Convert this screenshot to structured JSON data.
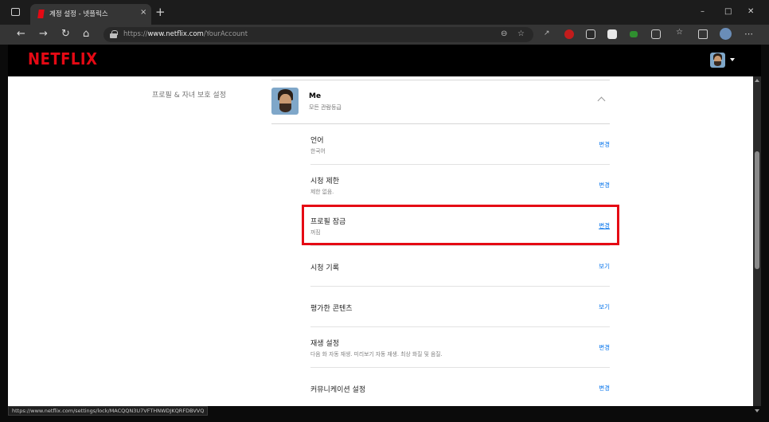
{
  "browser": {
    "tab_title": "계정 설정 - 넷플릭스",
    "tab_close": "×",
    "new_tab": "+",
    "url_scheme": "https://",
    "url_host": "www.netflix.com",
    "url_path": "/YourAccount",
    "window_controls": {
      "minimize": "–",
      "maximize": "□",
      "close": "✕"
    },
    "nav": {
      "back": "←",
      "forward": "→",
      "reload": "↻",
      "home": "⌂"
    },
    "toolbar_more": "⋯",
    "status_url": "https://www.netflix.com/settings/lock/MACQQN3U7VFTHNWDJKQRFDBVVQ"
  },
  "netflix": {
    "logo": "NETFLIX",
    "section_label": "프로필 & 자녀 보호 설정",
    "profile": {
      "name": "Me",
      "maturity": "모든 관람등급"
    },
    "settings": [
      {
        "title": "언어",
        "subtitle": "한국어",
        "action": "변경"
      },
      {
        "title": "시청 제한",
        "subtitle": "제한 없음.",
        "action": "변경"
      },
      {
        "title": "프로필 잠금",
        "subtitle": "꺼짐",
        "action": "변경",
        "highlighted": true
      },
      {
        "title": "시청 기록",
        "subtitle": "",
        "action": "보기"
      },
      {
        "title": "평가한 콘텐츠",
        "subtitle": "",
        "action": "보기"
      },
      {
        "title": "재생 설정",
        "subtitle": "다음 화 자동 재생. 미리보기 자동 재생. 최상 화질 및 음질.",
        "action": "변경"
      },
      {
        "title": "커뮤니케이션 설정",
        "subtitle": "",
        "action": "변경"
      }
    ]
  },
  "colors": {
    "brand": "#e50914",
    "link": "#0071eb",
    "highlight": "#e50914"
  }
}
